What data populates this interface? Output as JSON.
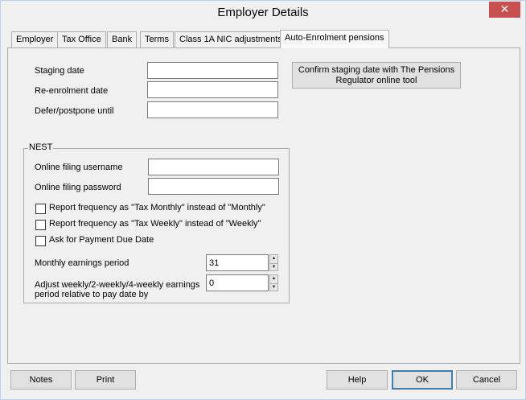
{
  "window": {
    "title": "Employer Details",
    "close_glyph": "✕"
  },
  "tabs": [
    {
      "label": "Employer"
    },
    {
      "label": "Tax Office"
    },
    {
      "label": "Bank"
    },
    {
      "label": "Terms"
    },
    {
      "label": "Class 1A NIC adjustments"
    },
    {
      "label": "Auto-Enrolment pensions"
    }
  ],
  "staging": {
    "staging_date_label": "Staging date",
    "staging_date_value": "",
    "reenrolment_label": "Re-enrolment date",
    "reenrolment_value": "",
    "defer_label": "Defer/postpone until",
    "defer_value": "",
    "confirm_button_line1": "Confirm staging date with The Pensions",
    "confirm_button_line2": "Regulator online tool"
  },
  "nest": {
    "group_title": "NEST",
    "username_label": "Online filing username",
    "username_value": "",
    "password_label": "Online filing password",
    "password_value": "",
    "check_tax_monthly": "Report frequency as \"Tax Monthly\" instead of \"Monthly\"",
    "check_tax_weekly": "Report frequency as \"Tax Weekly\" instead of \"Weekly\"",
    "check_payment_due": "Ask for Payment Due Date",
    "monthly_period_label": "Monthly earnings period",
    "monthly_period_value": "31",
    "adjust_label_line1": "Adjust weekly/2-weekly/4-weekly earnings",
    "adjust_label_line2": "period relative to pay date by",
    "adjust_value": "0",
    "spin_up_glyph": "▲",
    "spin_down_glyph": "▼"
  },
  "footer": {
    "notes": "Notes",
    "print": "Print",
    "help": "Help",
    "ok": "OK",
    "cancel": "Cancel"
  },
  "colors": {
    "close_button": "#c75050",
    "window_border": "#b9d1ea",
    "default_button_border": "#3c7fb1"
  }
}
